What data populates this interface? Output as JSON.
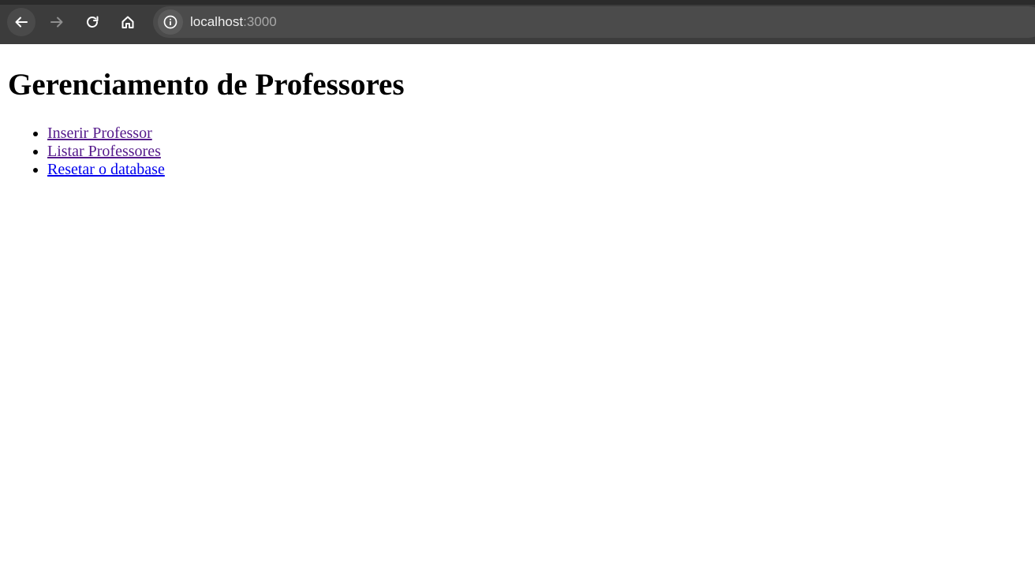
{
  "browser": {
    "url_host": "localhost",
    "url_port": ":3000"
  },
  "page": {
    "title": "Gerenciamento de Professores",
    "links": [
      {
        "label": "Inserir Professor",
        "state": "visited"
      },
      {
        "label": "Listar Professores",
        "state": "visited"
      },
      {
        "label": "Resetar o database",
        "state": "unvisited"
      }
    ]
  },
  "colors": {
    "toolbar": "#3c3c3c",
    "visited_link": "#551a8b",
    "unvisited_link": "#0000ee"
  },
  "icons": {
    "back": "arrow-left-icon",
    "forward": "arrow-right-icon",
    "reload": "reload-icon",
    "home": "home-icon",
    "site_info": "info-icon"
  }
}
